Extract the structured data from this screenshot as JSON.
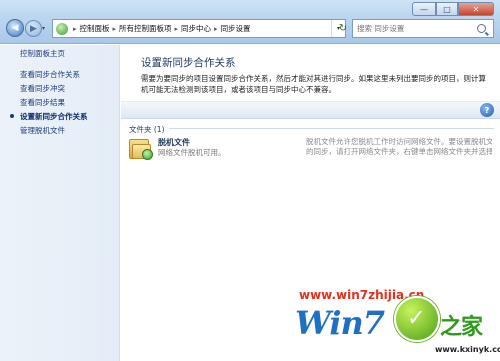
{
  "window": {
    "controls": {
      "minimize": "—",
      "maximize": "□",
      "close": "✕"
    }
  },
  "navigation": {
    "back_icon": "◀",
    "forward_icon": "▶",
    "dropdown_icon": "▾",
    "breadcrumbs": [
      "控制面板",
      "所有控制面板项",
      "同步中心",
      "同步设置"
    ],
    "separator": "▸",
    "refresh_icon": "↻"
  },
  "search": {
    "placeholder": "搜索 同步设置"
  },
  "sidebar": {
    "items": [
      {
        "label": "控制面板主页"
      },
      {
        "label": "查看同步合作关系"
      },
      {
        "label": "查看同步冲突"
      },
      {
        "label": "查看同步结果"
      },
      {
        "label": "设置新同步合作关系"
      },
      {
        "label": "管理脱机文件"
      }
    ]
  },
  "main": {
    "title": "设置新同步合作关系",
    "description": "需要为要同步的项目设置同步合作关系，然后才能对其进行同步。如果这里未列出要同步的项目，则计算机可能无法检测到该项目，或者该项目与同步中心不兼容。",
    "help_icon": "?",
    "group_header": "文件夹 (1)",
    "items": [
      {
        "name": "脱机文件",
        "status": "网络文件脱机可用。",
        "detail_line1": "脱机文件允许您脱机工作时访问网络文件。要设置脱机文件",
        "detail_line2": "的同步，请打开网络文件夹，右键单击网络文件夹并选择"
      }
    ]
  },
  "watermark": {
    "url": "www.win7zhijia.cn",
    "logo_text": "Win7",
    "check_icon": "✓",
    "brand": "之家",
    "domain": "www.kxinyk.com"
  }
}
